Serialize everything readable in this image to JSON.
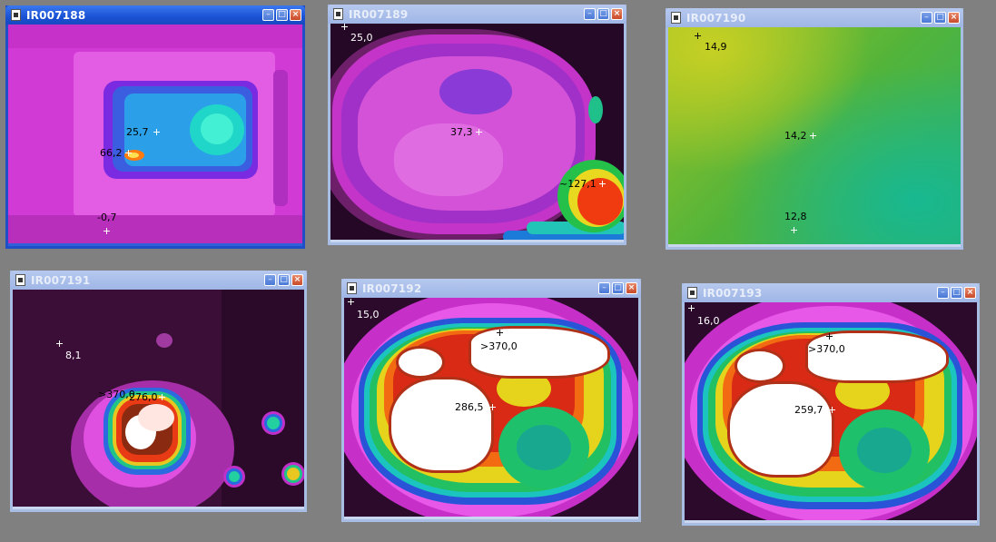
{
  "windows": [
    {
      "title": "IR007188",
      "icons": [
        "app-icon",
        "minimize-icon",
        "maximize-icon",
        "close-icon"
      ],
      "markers": [
        {
          "label": "25,7",
          "value": 25.7
        },
        {
          "label": "66,2",
          "value": 66.2
        },
        {
          "label": "-0,7",
          "value": -0.7
        }
      ]
    },
    {
      "title": "IR007189",
      "markers": [
        {
          "label": "25,0",
          "value": 25.0
        },
        {
          "label": "37,3",
          "value": 37.3
        },
        {
          "label": "~127,1",
          "value": 127.1
        }
      ]
    },
    {
      "title": "IR007190",
      "markers": [
        {
          "label": "14,9",
          "value": 14.9
        },
        {
          "label": "14,2",
          "value": 14.2
        },
        {
          "label": "12,8",
          "value": 12.8
        }
      ]
    },
    {
      "title": "IR007191",
      "markers": [
        {
          "label": "8,1",
          "value": 8.1
        },
        {
          "label": ">370,0",
          "value": 370.0
        },
        {
          "label": "276,0",
          "value": 276.0
        }
      ]
    },
    {
      "title": "IR007192",
      "markers": [
        {
          "label": "15,0",
          "value": 15.0
        },
        {
          "label": ">370,0",
          "value": 370.0
        },
        {
          "label": "286,5",
          "value": 286.5
        }
      ]
    },
    {
      "title": "IR007193",
      "markers": [
        {
          "label": "16,0",
          "value": 16.0
        },
        {
          "label": ">370,0",
          "value": 370.0
        },
        {
          "label": "259,7",
          "value": 259.7
        }
      ]
    }
  ],
  "colors": {
    "desktop": "#808080",
    "active_titlebar": "#1a52d4",
    "inactive_titlebar": "#a8bde3",
    "thermal_cold": "#2a0a2a",
    "thermal_low": "#ff33ff",
    "thermal_mid": "#00c070",
    "thermal_high": "#ff2020",
    "thermal_max": "#ffffff"
  }
}
